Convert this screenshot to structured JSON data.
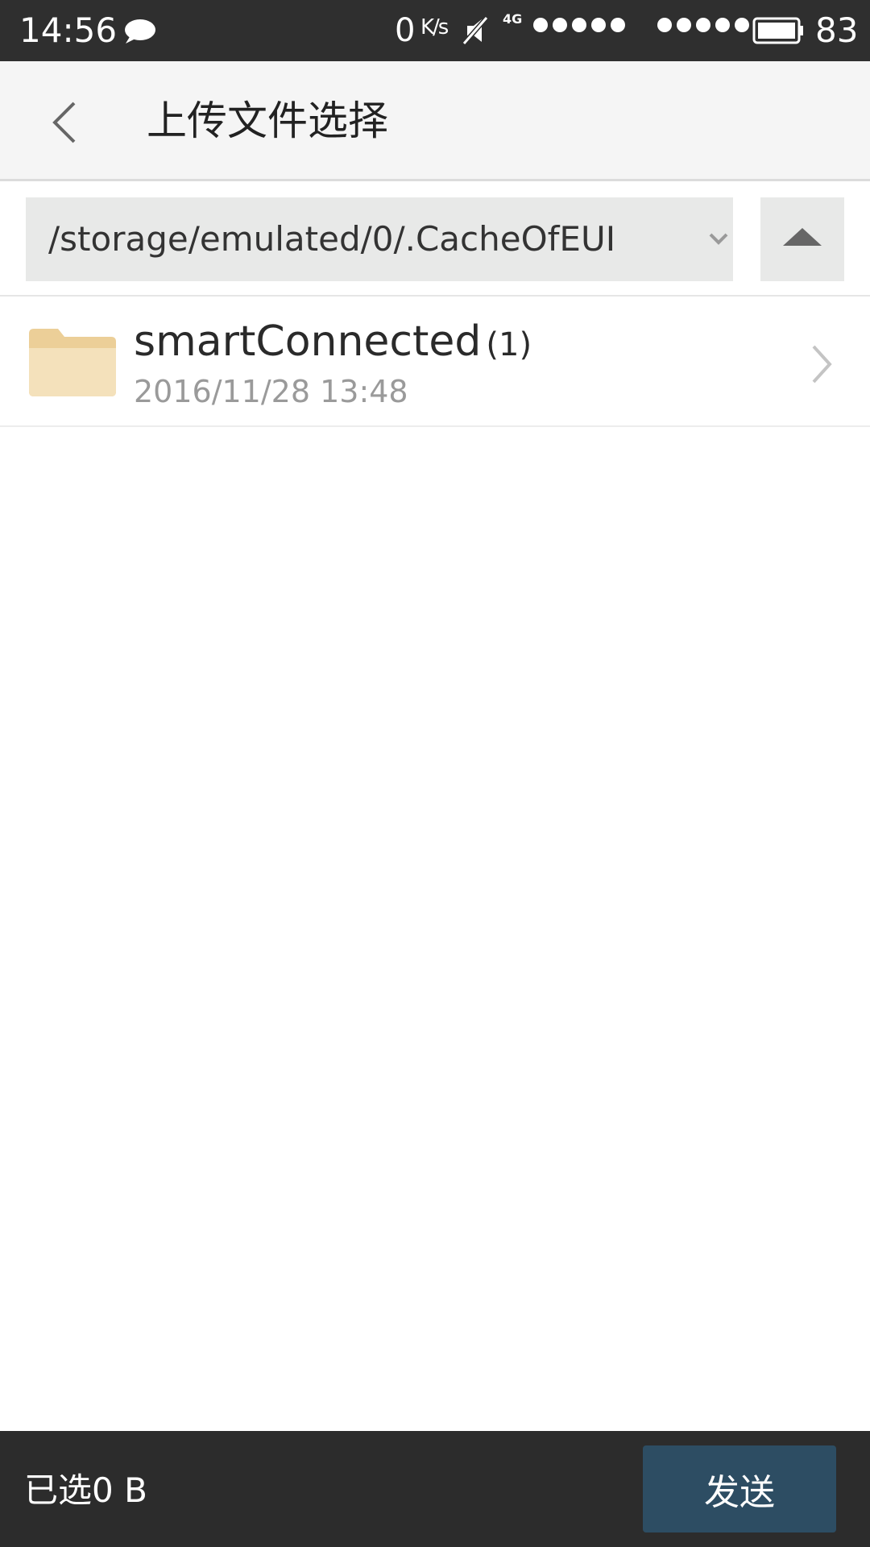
{
  "status_bar": {
    "time": "14:56",
    "speed_value": "0",
    "speed_unit": "K/s",
    "network_type": "4G",
    "battery_percent": "83"
  },
  "header": {
    "title": "上传文件选择"
  },
  "path_bar": {
    "current_path": "/storage/emulated/0/.CacheOfEUI"
  },
  "files": [
    {
      "name": "smartConnected",
      "count": "(1)",
      "date": "2016/11/28 13:48",
      "type": "folder"
    }
  ],
  "bottom_bar": {
    "selected_label": "已选0 B",
    "send_label": "发送"
  },
  "colors": {
    "status_bar_bg": "#2f2f2f",
    "header_bg": "#f5f5f5",
    "path_bg": "#e8e9e8",
    "folder": "#f3deb3",
    "bottom_bar_bg": "#2c2c2c",
    "send_button_bg": "#2d4d63"
  }
}
